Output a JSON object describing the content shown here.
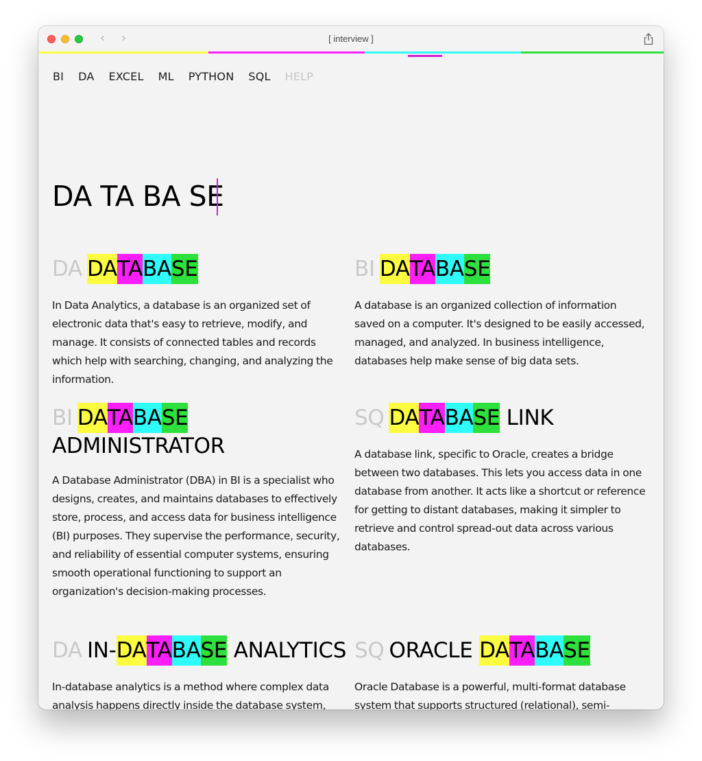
{
  "window": {
    "title": "[ interview ]"
  },
  "menu": [
    "BI",
    "DA",
    "EXCEL",
    "ML",
    "PYTHON",
    "SQL"
  ],
  "menu_help": "HELP",
  "hero": "DA TA BA SE",
  "colors": {
    "yellow": "#fcfc41",
    "magenta": "#fb1ff7",
    "cyan": "#2ffbfb",
    "green": "#2de03d"
  },
  "cards": [
    {
      "prefix": "DA",
      "before": "",
      "after": "",
      "segments": [
        "DA",
        "TA",
        "BA",
        "SE"
      ],
      "body": "In Data Analytics, a database is an organized set of electronic data that's easy to retrieve, modify, and manage. It consists of connected tables and records which help with searching, changing, and analyzing the information."
    },
    {
      "prefix": "BI",
      "before": "",
      "after": "",
      "segments": [
        "DA",
        "TA",
        "BA",
        "SE"
      ],
      "body": "A database is an organized collection of information saved on a computer. It's designed to be easily accessed, managed, and analyzed. In business intelligence, databases help make sense of big data sets."
    },
    {
      "prefix": "BI",
      "before": "",
      "after": "ADMINISTRATOR",
      "segments": [
        "DA",
        "TA",
        "BA",
        "SE"
      ],
      "body": "A Database Administrator (DBA) in BI is a specialist who designs, creates, and maintains databases to effectively store, process, and access data for business intelligence (BI) purposes. They supervise the performance, security, and reliability of essential computer systems, ensuring smooth operational functioning to support an organization's decision-making processes."
    },
    {
      "prefix": "SQ",
      "before": "",
      "after": "LINK",
      "segments": [
        "DA",
        "TA",
        "BA",
        "SE"
      ],
      "body": "A database link, specific to Oracle, creates a bridge between two databases. This lets you access data in one database from another. It acts like a shortcut or reference for getting to distant databases, making it simpler to retrieve and control spread-out data across various databases."
    },
    {
      "prefix": "DA",
      "before": "IN-",
      "after": "ANALYTICS",
      "segments": [
        "DA",
        "TA",
        "BA",
        "SE"
      ],
      "body": "In-database analytics is a method where complex data analysis happens directly inside the database system, instead of extracting or moving the data elsewhere. By doing this, it simplifies analysis and decision-making, making it faster and more efficient."
    },
    {
      "prefix": "SQ",
      "before": "ORACLE",
      "after": "",
      "segments": [
        "DA",
        "TA",
        "BA",
        "SE"
      ],
      "body": "Oracle Database is a powerful, multi-format database system that supports structured (relational), semi-structured (JSON), and unstructured data formats, developed by Oracle Corporation and widely used for enterprise data management."
    }
  ]
}
